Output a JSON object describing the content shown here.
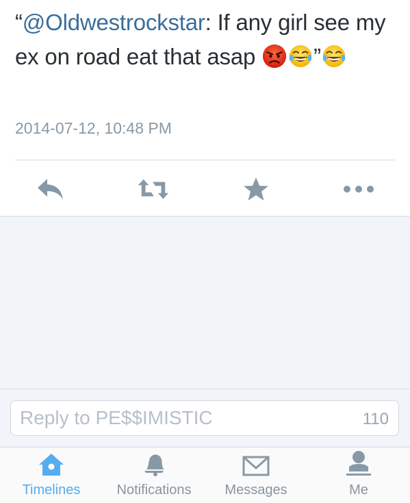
{
  "tweet": {
    "quote_open": "“",
    "mention": "@Oldwestrockstar",
    "text_after_mention": ": If any girl see my ex on road eat that asap ",
    "quote_close": "”",
    "emojis": [
      "angry-face",
      "face-with-tears-of-joy",
      "face-with-tears-of-joy"
    ],
    "timestamp": "2014-07-12, 10:48 PM"
  },
  "actions": {
    "reply_icon": "reply-icon",
    "retweet_icon": "retweet-icon",
    "favorite_icon": "star-icon",
    "more_icon": "more-icon"
  },
  "reply": {
    "placeholder": "Reply to PE$$IMISTIC",
    "char_count": "110"
  },
  "tabbar": {
    "timelines": "Timelines",
    "notifications": "Notifications",
    "messages": "Messages",
    "me": "Me"
  },
  "colors": {
    "accent": "#55acee",
    "mention": "#3b6e99",
    "icon_gray": "#8899a6",
    "background": "#f1f4f8"
  }
}
